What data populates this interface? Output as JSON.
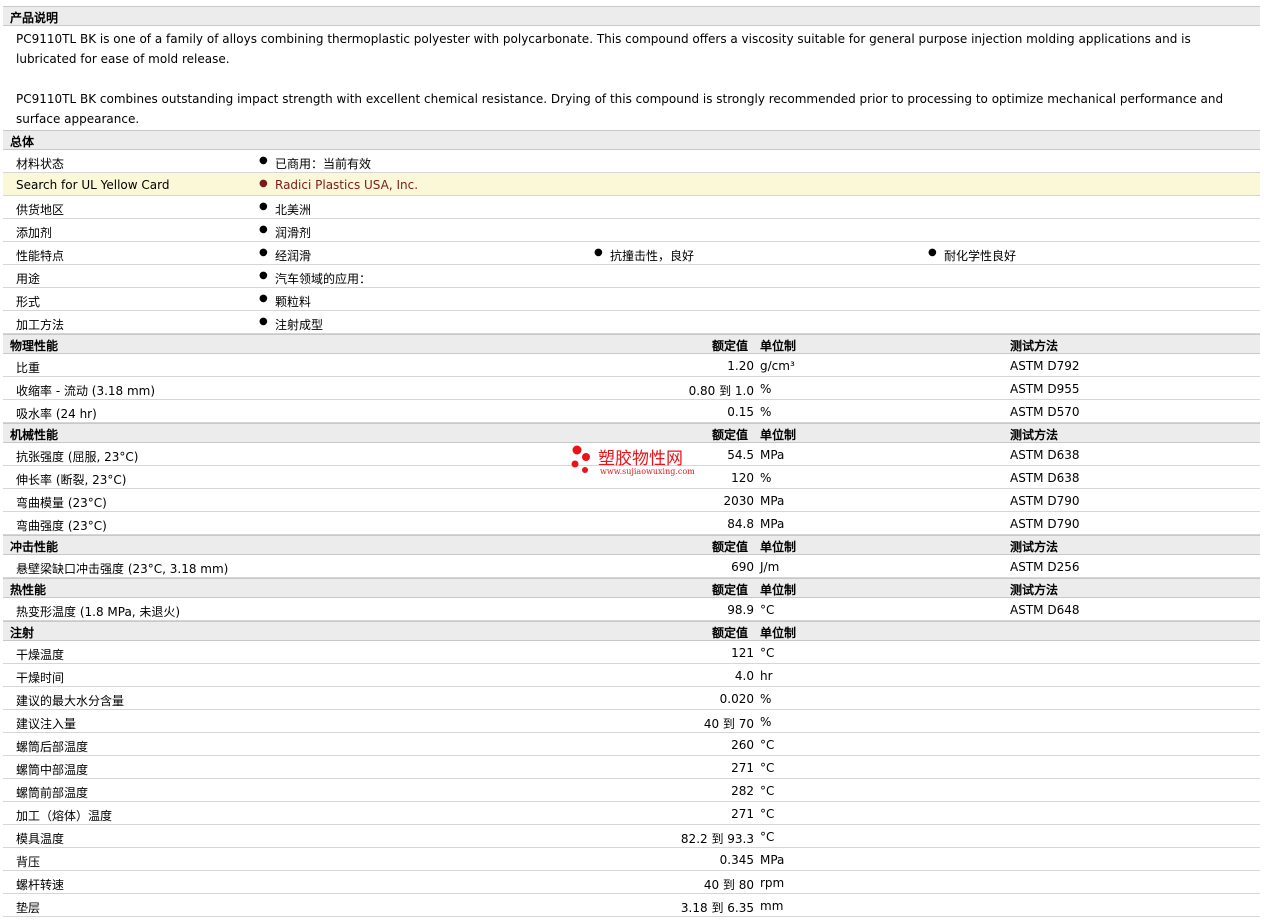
{
  "description": {
    "title": "产品说明",
    "p1": "PC9110TL BK is one of a family of alloys combining thermoplastic polyester with polycarbonate. This compound offers a viscosity suitable for general purpose injection molding applications and is lubricated for ease of mold release.",
    "p2": "PC9110TL BK combines outstanding impact strength with excellent chemical resistance. Drying of this compound is strongly recommended prior to processing to optimize mechanical performance and surface appearance."
  },
  "general": {
    "title": "总体",
    "rows": [
      {
        "label": "材料状态",
        "values": [
          "已商用：当前有效"
        ]
      },
      {
        "label": "Search for UL Yellow Card",
        "values": [
          "Radici Plastics USA, Inc."
        ]
      },
      {
        "label": "供货地区",
        "values": [
          "北美洲"
        ]
      },
      {
        "label": "添加剂",
        "values": [
          "润滑剂"
        ]
      },
      {
        "label": "性能特点",
        "values": [
          "经润滑",
          "抗撞击性，良好",
          "耐化学性良好"
        ]
      },
      {
        "label": "用途",
        "values": [
          "汽车领域的应用："
        ]
      },
      {
        "label": "形式",
        "values": [
          "颗粒料"
        ]
      },
      {
        "label": "加工方法",
        "values": [
          "注射成型"
        ]
      }
    ]
  },
  "headers": {
    "value": "额定值",
    "unit": "单位制",
    "method": "测试方法"
  },
  "physical": {
    "title": "物理性能",
    "rows": [
      {
        "label": "比重",
        "value": "1.20",
        "unit": "g/cm³",
        "method": "ASTM D792"
      },
      {
        "label": "收缩率  - 流动  (3.18 mm)",
        "value": "0.80 到  1.0",
        "unit": "%",
        "method": "ASTM D955"
      },
      {
        "label": "吸水率  (24 hr)",
        "value": "0.15",
        "unit": "%",
        "method": "ASTM D570"
      }
    ]
  },
  "mechanical": {
    "title": "机械性能",
    "rows": [
      {
        "label": "抗张强度  (屈服, 23°C)",
        "value": "54.5",
        "unit": "MPa",
        "method": "ASTM D638"
      },
      {
        "label": "伸长率  (断裂, 23°C)",
        "value": "120",
        "unit": "%",
        "method": "ASTM D638"
      },
      {
        "label": "弯曲模量  (23°C)",
        "value": "2030",
        "unit": "MPa",
        "method": "ASTM D790"
      },
      {
        "label": "弯曲强度  (23°C)",
        "value": "84.8",
        "unit": "MPa",
        "method": "ASTM D790"
      }
    ]
  },
  "impact": {
    "title": "冲击性能",
    "rows": [
      {
        "label": "悬壁梁缺口冲击强度  (23°C, 3.18 mm)",
        "value": "690",
        "unit": "J/m",
        "method": "ASTM D256"
      }
    ]
  },
  "thermal": {
    "title": "热性能",
    "rows": [
      {
        "label": "热变形温度  (1.8 MPa, 未退火)",
        "value": "98.9",
        "unit": "°C",
        "method": "ASTM D648"
      }
    ]
  },
  "injection": {
    "title": "注射",
    "rows": [
      {
        "label": "干燥温度",
        "value": "121",
        "unit": "°C"
      },
      {
        "label": "干燥时间",
        "value": "4.0",
        "unit": "hr"
      },
      {
        "label": "建议的最大水分含量",
        "value": "0.020",
        "unit": "%"
      },
      {
        "label": "建议注入量",
        "value": "40 到  70",
        "unit": "%"
      },
      {
        "label": "螺筒后部温度",
        "value": "260",
        "unit": "°C"
      },
      {
        "label": "螺筒中部温度",
        "value": "271",
        "unit": "°C"
      },
      {
        "label": "螺筒前部温度",
        "value": "282",
        "unit": "°C"
      },
      {
        "label": "加工（熔体）温度",
        "value": "271",
        "unit": "°C"
      },
      {
        "label": "模具温度",
        "value": "82.2 到  93.3",
        "unit": "°C"
      },
      {
        "label": "背压",
        "value": "0.345",
        "unit": "MPa"
      },
      {
        "label": "螺杆转速",
        "value": "40 到  80",
        "unit": "rpm"
      },
      {
        "label": "垫层",
        "value": "3.18 到  6.35",
        "unit": "mm"
      }
    ]
  },
  "watermark": {
    "name": "塑胶物性网",
    "url": "www.sujiaowuxing.com",
    "color": "#e8141b"
  }
}
